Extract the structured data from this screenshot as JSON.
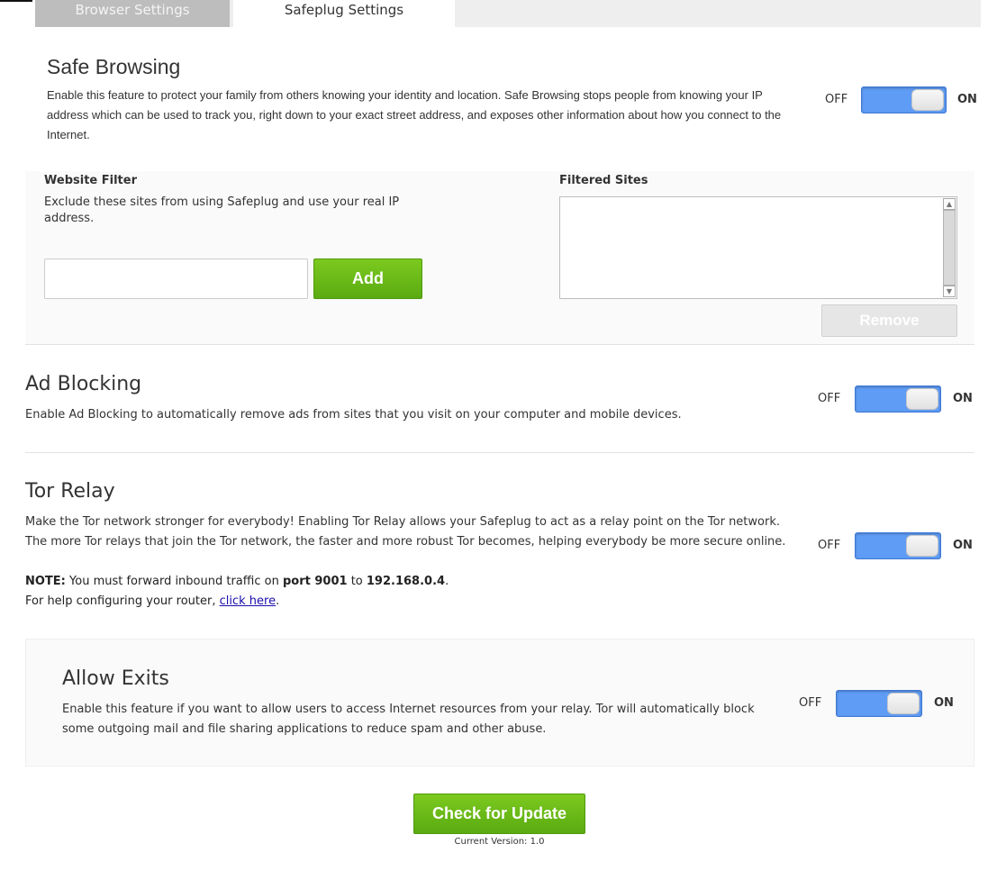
{
  "tabs": [
    {
      "label": "Browser Settings"
    },
    {
      "label": "Safeplug Settings"
    }
  ],
  "safe_browsing": {
    "title": "Safe Browsing",
    "description": "Enable this feature to protect your family from others knowing your identity and location. Safe Browsing stops people from knowing your IP address which can be used to track you, right down to your exact street address, and exposes other information about how you connect to the Internet.",
    "toggle": {
      "off_label": "OFF",
      "on_label": "ON",
      "state": "on"
    }
  },
  "website_filter": {
    "title": "Website Filter",
    "description": "Exclude these sites from using Safeplug and use your real IP address.",
    "input_value": "",
    "add_label": "Add",
    "filtered_title": "Filtered Sites",
    "filtered_sites": [],
    "remove_label": "Remove"
  },
  "ad_blocking": {
    "title": "Ad Blocking",
    "description": "Enable Ad Blocking to automatically remove ads from sites that you visit on your computer and mobile devices.",
    "toggle": {
      "off_label": "OFF",
      "on_label": "ON",
      "state": "on"
    }
  },
  "tor_relay": {
    "title": "Tor Relay",
    "description": "Make the Tor network stronger for everybody! Enabling Tor Relay allows your Safeplug to act as a relay point on the Tor network. The more Tor relays that join the Tor network, the faster and more robust Tor becomes, helping everybody be more secure online.",
    "toggle": {
      "off_label": "OFF",
      "on_label": "ON",
      "state": "on"
    },
    "note_label": "NOTE:",
    "note_text_1": "You must forward inbound traffic on",
    "note_port": "port 9001",
    "note_text_2": "to",
    "note_ip": "192.168.0.4",
    "note_period": ".",
    "help_text": "For help configuring your router,",
    "help_link": "click here",
    "help_period": "."
  },
  "allow_exits": {
    "title": "Allow Exits",
    "description": "Enable this feature if you want to allow users to access Internet resources from your relay. Tor will automatically block some outgoing mail and file sharing applications to reduce spam and other abuse.",
    "toggle": {
      "off_label": "OFF",
      "on_label": "ON",
      "state": "on"
    }
  },
  "update": {
    "button_label": "Check for Update",
    "version_text": "Current Version: 1.0"
  },
  "colors": {
    "toggle_on": "#5f9cf5",
    "button_green": "#6bbb18",
    "link": "#1a0dab"
  }
}
